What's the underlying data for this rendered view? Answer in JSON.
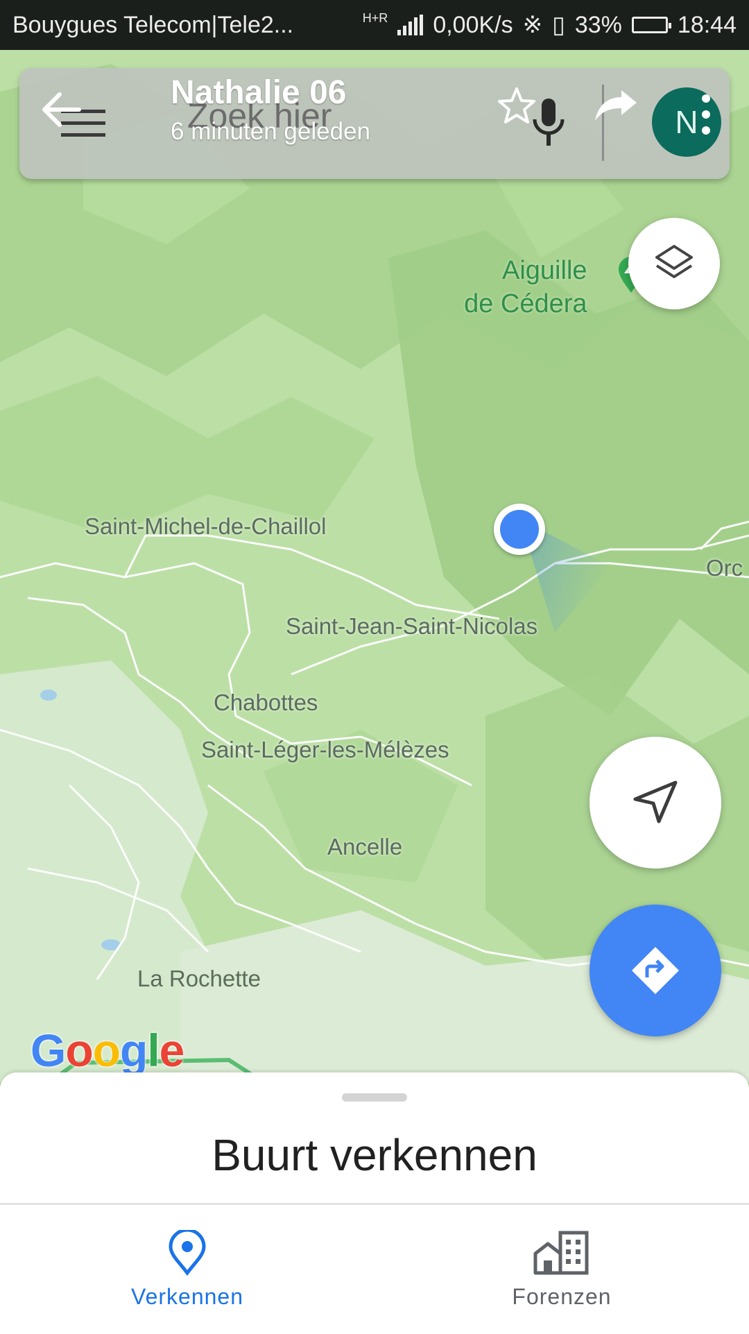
{
  "status_bar": {
    "carrier": "Bouygues Telecom|Tele2...",
    "network_type": "H+R",
    "data_rate": "0,00K/s",
    "battery": "33%",
    "time": "18:44"
  },
  "top_bar": {
    "search_placeholder": "Zoek hier",
    "shared_contact_name": "Nathalie 06",
    "last_update": "6 minuten geleden",
    "avatar_letter": "N",
    "avatar_color": "#0b6b5d"
  },
  "map": {
    "labels": [
      {
        "id": "saint-michel",
        "text": "Saint-Michel-de-Chaillol"
      },
      {
        "id": "saint-jean",
        "text": "Saint-Jean-Saint-Nicolas"
      },
      {
        "id": "chabottes",
        "text": "Chabottes"
      },
      {
        "id": "saint-leger",
        "text": "Saint-Léger-les-Mélèzes"
      },
      {
        "id": "ancelle",
        "text": "Ancelle"
      },
      {
        "id": "la-rochette",
        "text": "La Rochette"
      },
      {
        "id": "orc",
        "text": "Orc"
      }
    ],
    "poi": {
      "line1": "Aiguille",
      "line2": "de Cédera",
      "icon": "mountain-pin-icon"
    },
    "location_dot_color": "#4285f4",
    "attribution": {
      "letters": [
        "G",
        "o",
        "o",
        "g",
        "l",
        "e"
      ],
      "colors": [
        "#4285f4",
        "#ea4335",
        "#fbbc05",
        "#4285f4",
        "#34a853",
        "#ea4335"
      ]
    }
  },
  "bottom_sheet": {
    "title": "Buurt verkennen"
  },
  "bottom_nav": {
    "items": [
      {
        "label": "Verkennen",
        "icon": "location-pin-icon",
        "active": true
      },
      {
        "label": "Forenzen",
        "icon": "commute-buildings-icon",
        "active": false
      }
    ]
  },
  "colors": {
    "accent": "#1a73e8",
    "fab_blue": "#4285f4"
  }
}
